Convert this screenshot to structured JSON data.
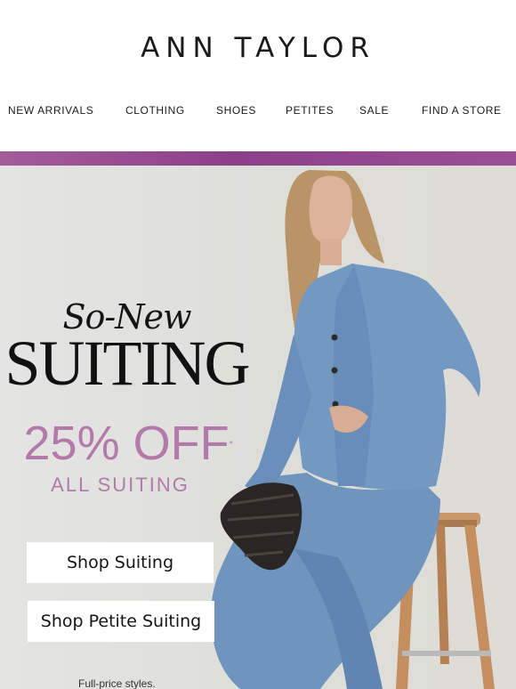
{
  "brand": {
    "logo": "ANN TAYLOR"
  },
  "nav": [
    {
      "label": "NEW ARRIVALS"
    },
    {
      "label": "CLOTHING"
    },
    {
      "label": "SHOES"
    },
    {
      "label": "PETITES"
    },
    {
      "label": "SALE"
    },
    {
      "label": "FIND A STORE"
    }
  ],
  "hero": {
    "eyebrow": "So-New",
    "headline": "SUITING",
    "offer": "25% OFF",
    "offer_mark": "*",
    "offer_sub": "ALL SUITING",
    "cta_primary": "Shop Suiting",
    "cta_secondary": "Shop Petite Suiting",
    "footnote": "Full-price styles."
  },
  "colors": {
    "accent": "#b27aaa",
    "band": "#8c3f8a",
    "suit": "#6f94bd"
  }
}
